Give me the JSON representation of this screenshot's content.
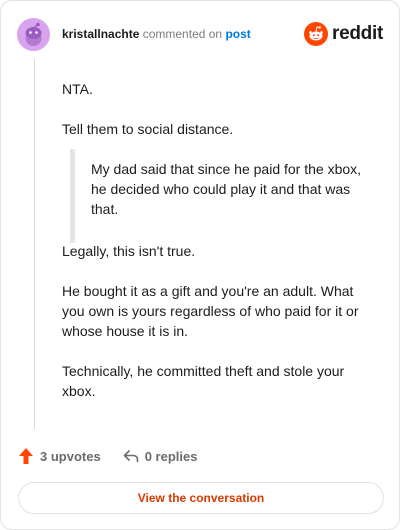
{
  "header": {
    "author": "kristallnachte",
    "action_text": "commented on",
    "post_link": "post",
    "brand": "reddit"
  },
  "comment": {
    "paragraphs_before": [
      "NTA.",
      "Tell them to social distance."
    ],
    "quote": "My dad said that since he paid for the xbox, he decided who could play it and that was that.",
    "paragraphs_after": [
      "Legally, this isn't true.",
      "He bought it as a gift and you're an adult. What you own is yours regardless of who paid for it or whose house it is in.",
      "Technically, he committed theft and stole your xbox."
    ]
  },
  "actions": {
    "upvotes": "3 upvotes",
    "replies": "0 replies"
  },
  "cta": {
    "label": "View the conversation"
  },
  "colors": {
    "upvote": "#ff4500",
    "brand": "#ff4500",
    "link": "#0079d3",
    "cta_text": "#d93a00"
  }
}
